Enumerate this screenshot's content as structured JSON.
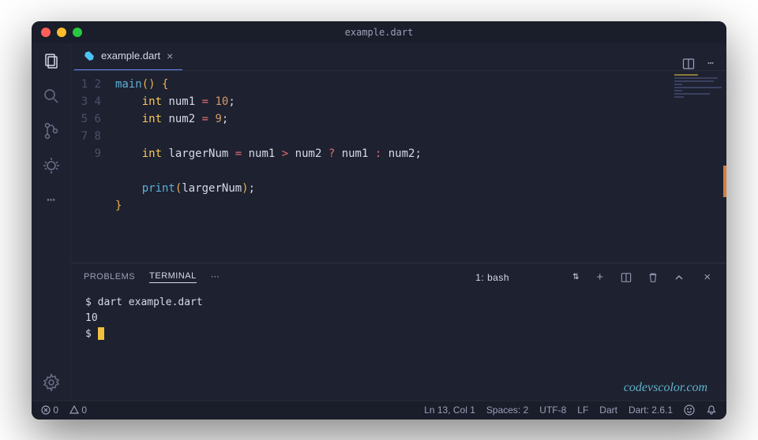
{
  "title": "example.dart",
  "tab": {
    "label": "example.dart"
  },
  "code": {
    "lines": [
      1,
      2,
      3,
      4,
      5,
      6,
      7,
      8,
      9
    ]
  },
  "code_tokens": {
    "main": "main",
    "int": "int",
    "num1": "num1",
    "num2": "num2",
    "eq": "=",
    "ten": "10",
    "nine": "9",
    "largerNum": "largerNum",
    "gt": ">",
    "q": "?",
    "colon": ":",
    "semi": ";",
    "print": "print",
    "lp": "(",
    "rp": ")",
    "lb": "{",
    "rb": "}"
  },
  "panel": {
    "tabs": {
      "problems": "PROBLEMS",
      "terminal": "TERMINAL"
    },
    "dropdown": "1: bash",
    "terminal": {
      "line1": "$ dart example.dart",
      "line2": "10",
      "line3": "$ "
    }
  },
  "statusbar": {
    "errors": "0",
    "warnings": "0",
    "ln": "Ln 13, Col 1",
    "spaces": "Spaces: 2",
    "encoding": "UTF-8",
    "eol": "LF",
    "lang": "Dart",
    "sdk": "Dart: 2.6.1"
  },
  "watermark": "codevscolor.com"
}
